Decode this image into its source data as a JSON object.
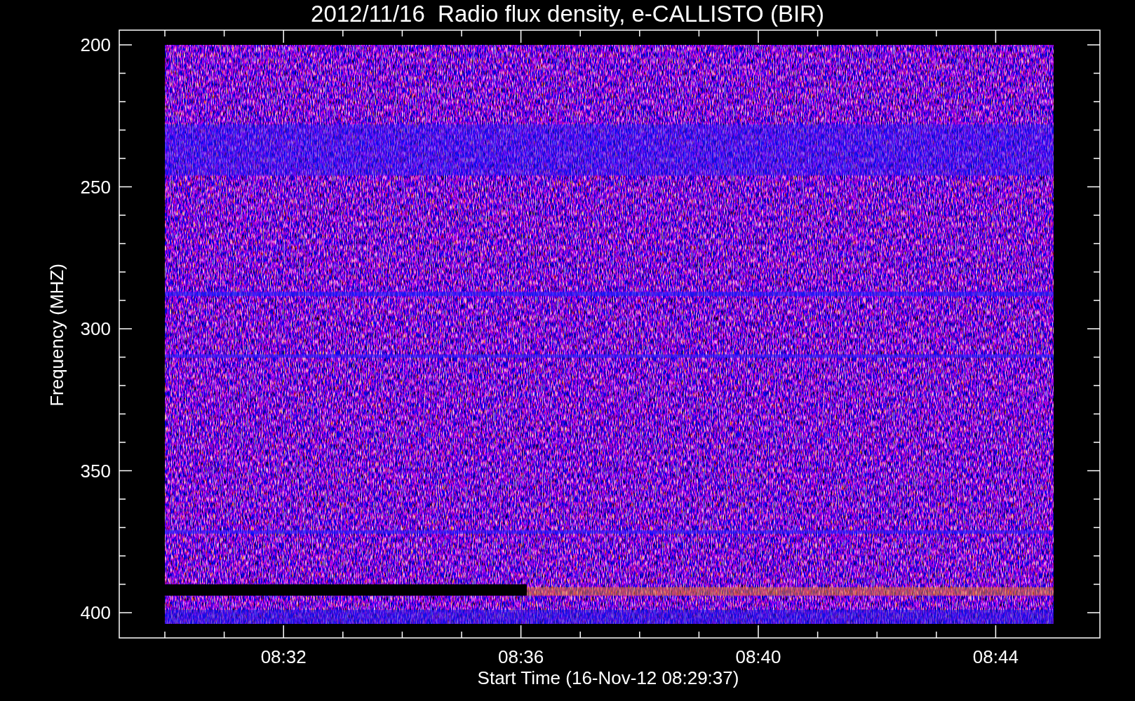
{
  "title": "2012/11/16  Radio flux density, e-CALLISTO (BIR)",
  "y_axis": {
    "label": "Frequency (MHZ)",
    "ticks": [
      "200",
      "250",
      "300",
      "350",
      "400"
    ]
  },
  "x_axis": {
    "label": "Start Time (16-Nov-12 08:29:37)",
    "ticks": [
      "08:32",
      "08:36",
      "08:40",
      "08:44"
    ]
  }
}
